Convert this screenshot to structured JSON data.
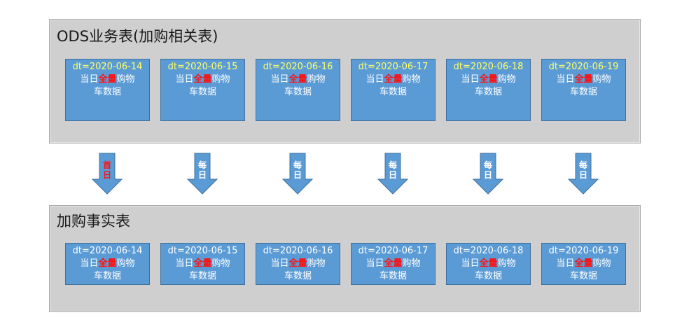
{
  "top_panel": {
    "title": "ODS业务表(加购相关表)",
    "boxes": [
      {
        "date": "dt=2020-06-14",
        "line1_pre": "当日",
        "line1_full": "全量",
        "line1_post": "购物",
        "line2": "车数据"
      },
      {
        "date": "dt=2020-06-15",
        "line1_pre": "当日",
        "line1_full": "全量",
        "line1_post": "购物",
        "line2": "车数据"
      },
      {
        "date": "dt=2020-06-16",
        "line1_pre": "当日",
        "line1_full": "全量",
        "line1_post": "购物",
        "line2": "车数据"
      },
      {
        "date": "dt=2020-06-17",
        "line1_pre": "当日",
        "line1_full": "全量",
        "line1_post": "购物",
        "line2": "车数据"
      },
      {
        "date": "dt=2020-06-18",
        "line1_pre": "当日",
        "line1_full": "全量",
        "line1_post": "购物",
        "line2": "车数据"
      },
      {
        "date": "dt=2020-06-19",
        "line1_pre": "当日",
        "line1_full": "全量",
        "line1_post": "购物",
        "line2": "车数据"
      }
    ]
  },
  "arrows": [
    {
      "line1": "首",
      "line2": "日",
      "color": "#ff1010"
    },
    {
      "line1": "每",
      "line2": "日",
      "color": "#ffffff"
    },
    {
      "line1": "每",
      "line2": "日",
      "color": "#ffffff"
    },
    {
      "line1": "每",
      "line2": "日",
      "color": "#ffffff"
    },
    {
      "line1": "每",
      "line2": "日",
      "color": "#ffffff"
    },
    {
      "line1": "每",
      "line2": "日",
      "color": "#ffffff"
    }
  ],
  "bottom_panel": {
    "title": "加购事实表",
    "boxes": [
      {
        "date": "dt=2020-06-14",
        "line1_pre": "当日",
        "line1_full": "全量",
        "line1_post": "购物",
        "line2": "车数据"
      },
      {
        "date": "dt=2020-06-15",
        "line1_pre": "当日",
        "line1_full": "全量",
        "line1_post": "购物",
        "line2": "车数据"
      },
      {
        "date": "dt=2020-06-16",
        "line1_pre": "当日",
        "line1_full": "全量",
        "line1_post": "购物",
        "line2": "车数据"
      },
      {
        "date": "dt=2020-06-17",
        "line1_pre": "当日",
        "line1_full": "全量",
        "line1_post": "购物",
        "line2": "车数据"
      },
      {
        "date": "dt=2020-06-18",
        "line1_pre": "当日",
        "line1_full": "全量",
        "line1_post": "购物",
        "line2": "车数据"
      },
      {
        "date": "dt=2020-06-19",
        "line1_pre": "当日",
        "line1_full": "全量",
        "line1_post": "购物",
        "line2": "车数据"
      }
    ]
  },
  "colors": {
    "box_fill": "#5b9bd5",
    "arrow_fill": "#5b9bd5",
    "panel_fill": "#cfcfcf",
    "top_date_text": "#ffff66",
    "highlight_text": "#ff1010"
  }
}
